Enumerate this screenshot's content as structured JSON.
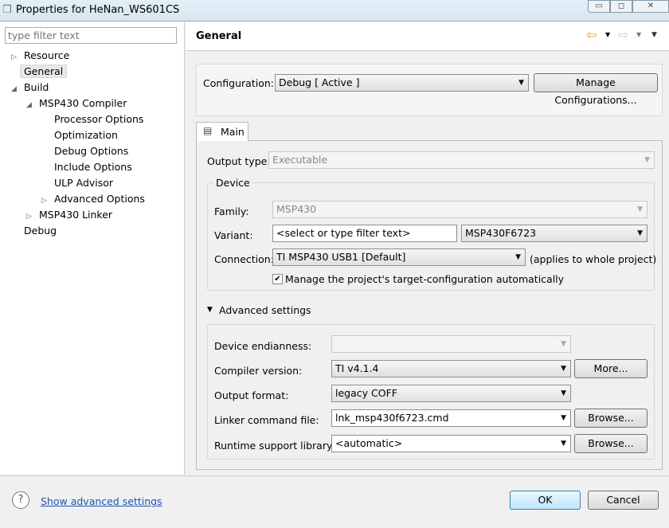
{
  "window": {
    "title": "Properties for HeNan_WS601CS",
    "minimize": "▭",
    "maximize": "◻",
    "close": "✕"
  },
  "filter": {
    "placeholder": "type filter text"
  },
  "tree": [
    {
      "label": "Resource",
      "twisty": "▷"
    },
    {
      "label": "General",
      "twisty": ""
    },
    {
      "label": "Build",
      "twisty": "◢"
    },
    {
      "label": "MSP430 Compiler",
      "twisty": "◢"
    },
    {
      "label": "Processor Options",
      "twisty": ""
    },
    {
      "label": "Optimization",
      "twisty": ""
    },
    {
      "label": "Debug Options",
      "twisty": ""
    },
    {
      "label": "Include Options",
      "twisty": ""
    },
    {
      "label": "ULP Advisor",
      "twisty": ""
    },
    {
      "label": "Advanced Options",
      "twisty": "▷"
    },
    {
      "label": "MSP430 Linker",
      "twisty": "▷"
    },
    {
      "label": "Debug",
      "twisty": ""
    }
  ],
  "header": {
    "title": "General",
    "back": "⇦",
    "forward": "⇨",
    "menu": "▼"
  },
  "config": {
    "label": "Configuration:",
    "value": "Debug  [ Active ]",
    "manage": "Manage Configurations..."
  },
  "tab": {
    "label": "Main"
  },
  "main": {
    "output_type_label": "Output type:",
    "output_type": "Executable",
    "device_group": "Device",
    "family_label": "Family:",
    "family": "MSP430",
    "variant_label": "Variant:",
    "variant_filter": "<select or type filter text>",
    "variant": "MSP430F6723",
    "connection_label": "Connection:",
    "connection": "TI MSP430 USB1 [Default]",
    "connection_note": "(applies to whole project)",
    "manage_target": "Manage the project's target-configuration automatically",
    "advanced_label": "Advanced settings",
    "endianness_label": "Device endianness:",
    "endianness": "",
    "compiler_label": "Compiler version:",
    "compiler": "TI v4.1.4",
    "more": "More...",
    "format_label": "Output format:",
    "format": "legacy COFF",
    "linker_label": "Linker command file:",
    "linker": "lnk_msp430f6723.cmd",
    "browse1": "Browse...",
    "runtime_label": "Runtime support library:",
    "runtime": "<automatic>",
    "browse2": "Browse..."
  },
  "footer": {
    "help": "?",
    "show_advanced": "Show advanced settings",
    "ok": "OK",
    "cancel": "Cancel"
  }
}
